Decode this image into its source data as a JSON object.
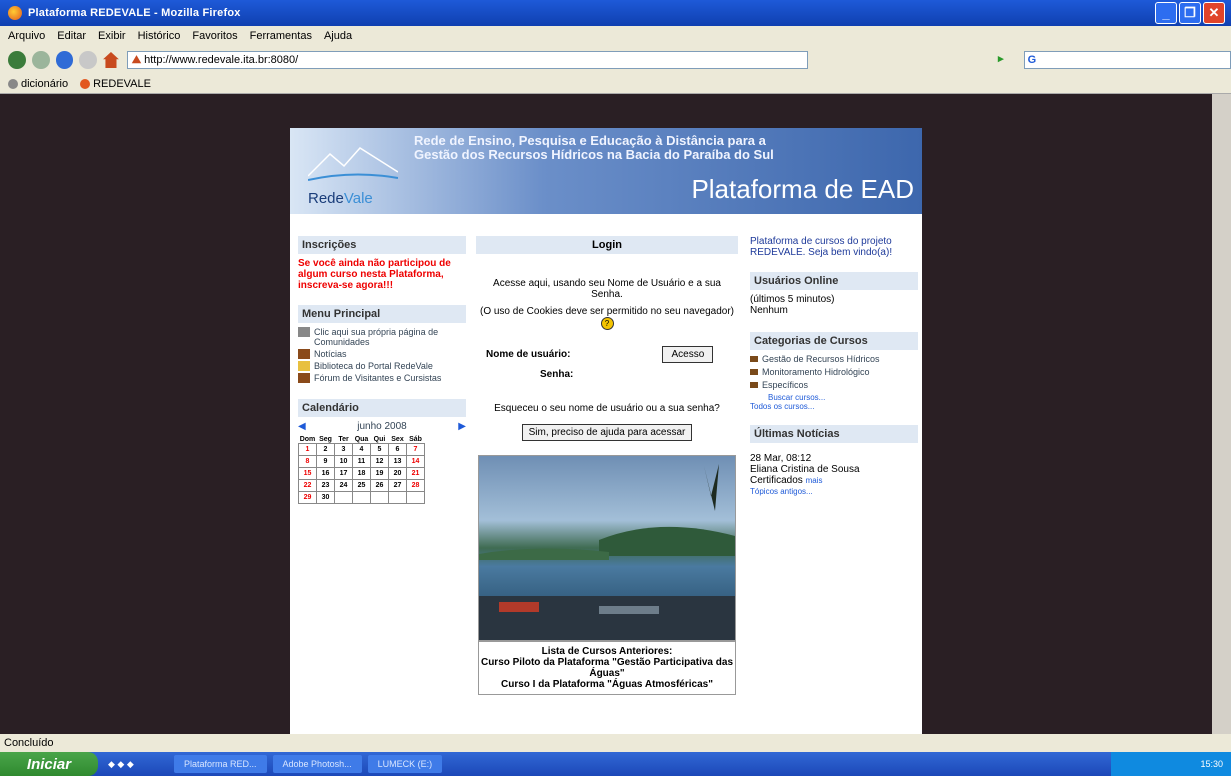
{
  "window": {
    "title": "Plataforma REDEVALE - Mozilla Firefox"
  },
  "menu": [
    "Arquivo",
    "Editar",
    "Exibir",
    "Histórico",
    "Favoritos",
    "Ferramentas",
    "Ajuda"
  ],
  "nav": {
    "url": "http://www.redevale.ita.br:8080/",
    "search_placeholder": "G"
  },
  "bookmarks": [
    "dicionário",
    "REDEVALE"
  ],
  "banner": {
    "logo": "Rede",
    "logo2": "Vale",
    "subtitle1": "Rede de Ensino, Pesquisa e Educação à Distância para a",
    "subtitle2": "Gestão dos Recursos Hídricos na Bacia do Paraíba do Sul",
    "title": "Plataforma de EAD"
  },
  "left": {
    "inscricoes_h": "Inscrições",
    "inscricoes_text": "Se você ainda não participou de algum curso nesta Plataforma, inscreva-se agora!!!",
    "menu_h": "Menu Principal",
    "menu_items": [
      "Clic aqui sua própria página de Comunidades",
      "Notícias",
      "Biblioteca do Portal RedeVale",
      "Fórum de Visitantes e Cursistas"
    ],
    "calendar_h": "Calendário",
    "calendar_month": "junho 2008",
    "calendar_days": [
      "Dom",
      "Seg",
      "Ter",
      "Qua",
      "Qui",
      "Sex",
      "Sáb"
    ],
    "calendar_rows": [
      [
        "1",
        "2",
        "3",
        "4",
        "5",
        "6",
        "7"
      ],
      [
        "8",
        "9",
        "10",
        "11",
        "12",
        "13",
        "14"
      ],
      [
        "15",
        "16",
        "17",
        "18",
        "19",
        "20",
        "21"
      ],
      [
        "22",
        "23",
        "24",
        "25",
        "26",
        "27",
        "28"
      ],
      [
        "29",
        "30",
        "",
        "",
        "",
        "",
        ""
      ]
    ]
  },
  "center": {
    "login_h": "Login",
    "intro": "Acesse aqui, usando seu Nome de Usuário e a sua Senha.",
    "cookies": "(O uso de Cookies deve ser permitido no seu navegador)",
    "user_label": "Nome de usuário:",
    "pass_label": "Senha:",
    "login_btn": "Acesso",
    "forgot": "Esqueceu o seu nome de usuário ou a sua senha?",
    "help_btn": "Sim, preciso de ajuda para acessar",
    "cursos_h": "Lista de Cursos Anteriores:",
    "curso1": "Curso Piloto da Plataforma \"Gestão Participativa das Águas\"",
    "curso2": "Curso I da Plataforma \"Águas Atmosféricas\""
  },
  "right": {
    "intro": "Plataforma de cursos do projeto REDEVALE. Seja bem vindo(a)!",
    "online_h": "Usuários Online",
    "online_sub": "(últimos 5 minutos)",
    "online_val": "Nenhum",
    "cat_h": "Categorias de Cursos",
    "cats": [
      "Gestão de Recursos Hídricos",
      "Monitoramento Hidrológico",
      "Específicos"
    ],
    "buscar": "Buscar cursos...",
    "todos": "Todos os cursos...",
    "news_h": "Últimas Notícias",
    "news_date": "28 Mar, 08:12",
    "news_author": "Eliana Cristina de Sousa",
    "news_title": "Certificados",
    "news_more": "mais",
    "news_old": "Tópicos antigos..."
  },
  "status": "Concluído",
  "taskbar": {
    "start": "Iniciar",
    "tasks": [
      "Plataforma RED...",
      "Adobe Photosh...",
      "LUMECK (E:)"
    ],
    "time": "15:30"
  }
}
